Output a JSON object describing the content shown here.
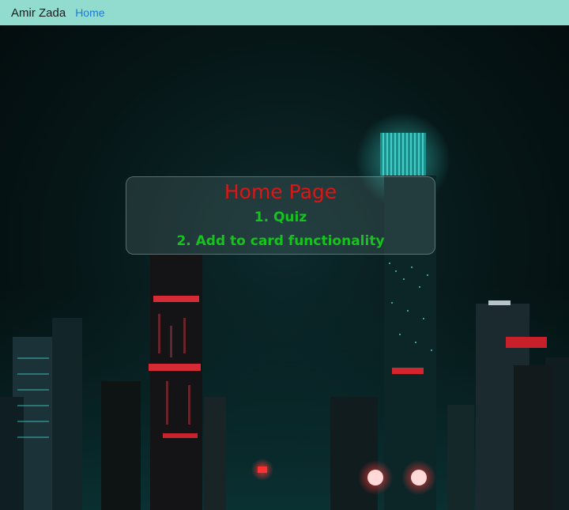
{
  "navbar": {
    "brand": "Amir Zada",
    "links": [
      {
        "label": "Home"
      }
    ]
  },
  "hero": {
    "title": "Home Page",
    "items": [
      {
        "label": "1. Quiz"
      },
      {
        "label": "2. Add to card functionality"
      }
    ]
  },
  "colors": {
    "navbar_bg": "#91dccf",
    "title": "#e01414",
    "items": "#17c21f",
    "link": "#1a7bd6"
  }
}
